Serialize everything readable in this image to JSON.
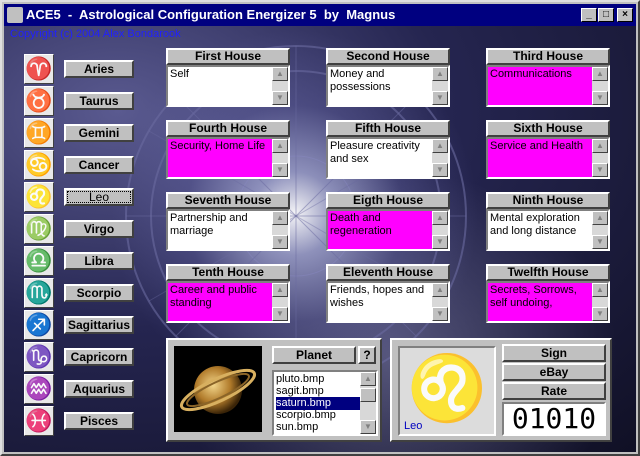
{
  "window": {
    "title": "ACE5  -  Astrological Configuration Energizer 5  by  Magnus",
    "minimize": "_",
    "maximize": "□",
    "close": "×"
  },
  "copyright": "Copyright (c) 2004 Alex Bondarook",
  "signs": [
    {
      "name": "Aries",
      "symbol": "♈",
      "color": "#c89000"
    },
    {
      "name": "Taurus",
      "symbol": "♉",
      "color": "#2f7f2f"
    },
    {
      "name": "Gemini",
      "symbol": "♊",
      "color": "#a0a0a0"
    },
    {
      "name": "Cancer",
      "symbol": "♋",
      "color": "#2040c0"
    },
    {
      "name": "Leo",
      "symbol": "♌",
      "color": "#e07000"
    },
    {
      "name": "Virgo",
      "symbol": "♍",
      "color": "#5a8a20"
    },
    {
      "name": "Libra",
      "symbol": "♎",
      "color": "#a0a0a0"
    },
    {
      "name": "Scorpio",
      "symbol": "♏",
      "color": "#2040a0"
    },
    {
      "name": "Sagittarius",
      "symbol": "♐",
      "color": "#e07000"
    },
    {
      "name": "Capricorn",
      "symbol": "♑",
      "color": "#2f7f2f"
    },
    {
      "name": "Aquarius",
      "symbol": "♒",
      "color": "#a0a0a0"
    },
    {
      "name": "Pisces",
      "symbol": "♓",
      "color": "#2040c0"
    }
  ],
  "selected_sign": "Leo",
  "houses": [
    {
      "title": "First House",
      "text": "Self",
      "highlight": false
    },
    {
      "title": "Second House",
      "text": "Money and possessions",
      "highlight": false
    },
    {
      "title": "Third House",
      "text": "Communications",
      "highlight": true
    },
    {
      "title": "Fourth House",
      "text": "Security, Home Life",
      "highlight": true
    },
    {
      "title": "Fifth House",
      "text": "Pleasure creativity and sex",
      "highlight": false
    },
    {
      "title": "Sixth House",
      "text": "Service and Health",
      "highlight": true
    },
    {
      "title": "Seventh House",
      "text": "Partnership and marriage",
      "highlight": false
    },
    {
      "title": "Eigth House",
      "text": "Death and regeneration",
      "highlight": true
    },
    {
      "title": "Ninth House",
      "text": "Mental exploration and long distance",
      "highlight": false
    },
    {
      "title": "Tenth House",
      "text": "Career and public standing",
      "highlight": true
    },
    {
      "title": "Eleventh House",
      "text": "Friends, hopes and wishes",
      "highlight": false
    },
    {
      "title": "Twelfth House",
      "text": "Secrets, Sorrows, self undoing,",
      "highlight": true
    }
  ],
  "planet_panel": {
    "planet_button": "Planet",
    "help_button": "?",
    "planets": [
      "pluto.bmp",
      "sagit.bmp",
      "saturn.bmp",
      "scorpio.bmp",
      "sun.bmp"
    ],
    "selected_planet": "saturn.bmp"
  },
  "sign_panel": {
    "sign_button": "Sign",
    "ebay_button": "eBay",
    "rate_button": "Rate",
    "symbol": "♌",
    "sign_label": "Leo",
    "counter": "01010"
  },
  "colors": {
    "highlight": "#ff00ff",
    "titlebar": "#000080",
    "sign_glyph": "#ff8000"
  }
}
